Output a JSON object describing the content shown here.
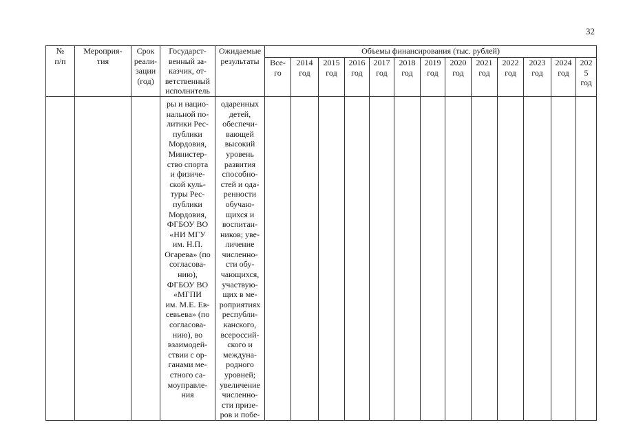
{
  "page_number": "32",
  "table": {
    "headers": {
      "num": "№\nп/п",
      "event": "Мероприя-\nтия",
      "term": "Срок\nреали-\nзации\n(год)",
      "customer": "Государст-\nвенный за-\nказчик, от-\nветственный\nисполнитель",
      "results": "Ожидаемые\nрезультаты",
      "funding": "Объемы финансирования (тыс. рублей)",
      "total": "Все-\nго",
      "years": [
        "2014\nгод",
        "2015\nгод",
        "2016\nгод",
        "2017\nгод",
        "2018\nгод",
        "2019\nгод",
        "2020\nгод",
        "2021\nгод",
        "2022\nгод",
        "2023\nгод",
        "2024\nгод",
        "202\n5\nгод"
      ]
    },
    "row": {
      "num": "",
      "event": "",
      "term": "",
      "customer": "ры и нацио-\nнальной по-\nлитики Рес-\nпублики\nМордовия,\nМинистер-\nство спорта\nи физиче-\nской куль-\nтуры Рес-\nпублики\nМордовия,\nФГБОУ ВО\n«НИ МГУ\nим. Н.П.\nОгарева» (по\nсогласова-\nнию),\nФГБОУ ВО\n«МГПИ\nим. М.Е. Ев-\nсевьева» (по\nсогласова-\nнию), во\nвзаимодей-\nствии с ор-\nганами ме-\nстного са-\nмоуправле-\nния",
      "results": "одаренных\nдетей,\nобеспечи-\nвающей\nвысокий\nуровень\nразвития\nспособно-\nстей и ода-\nренности\nобучаю-\nщихся и\nвоспитан-\nников; уве-\nличение\nчисленно-\nсти обу-\nчающихся,\nучаствую-\nщих в ме-\nроприятиях\nреспубли-\nканского,\nвсероссий-\nского и\nмеждуна-\nродного\nуровней;\nувеличение\nчисленно-\nсти призе-\nров и побе-"
    }
  }
}
